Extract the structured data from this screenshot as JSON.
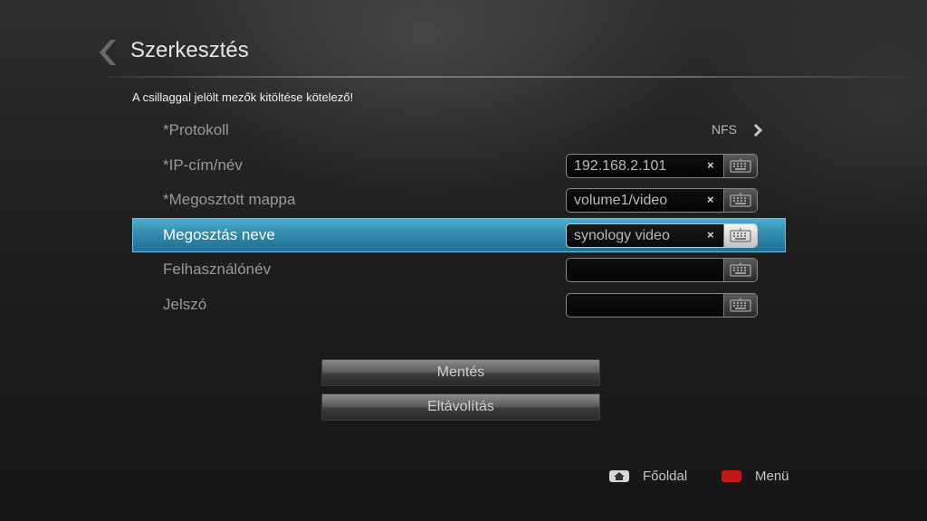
{
  "header": {
    "title": "Szerkesztés",
    "required_note": "A csillaggal jelölt mezők kitöltése kötelező!"
  },
  "form": {
    "rows": [
      {
        "label": "*Protokoll",
        "value": "NFS",
        "type": "selector"
      },
      {
        "label": "*IP-cím/név",
        "value": "192.168.2.101",
        "type": "text"
      },
      {
        "label": "*Megosztott mappa",
        "value": "volume1/video",
        "type": "text"
      },
      {
        "label": "Megosztás neve",
        "value": "synology video",
        "type": "text",
        "selected": true
      },
      {
        "label": "Felhasználónév",
        "value": "",
        "type": "text"
      },
      {
        "label": "Jelszó",
        "value": "",
        "type": "password"
      }
    ],
    "clear_symbol": "×"
  },
  "actions": {
    "save_label": "Mentés",
    "remove_label": "Eltávolítás"
  },
  "footer": {
    "home_label": "Főoldal",
    "menu_label": "Menü",
    "menu_key_color": "#c41818"
  },
  "colors": {
    "selection_accent": "#2e88ab"
  }
}
